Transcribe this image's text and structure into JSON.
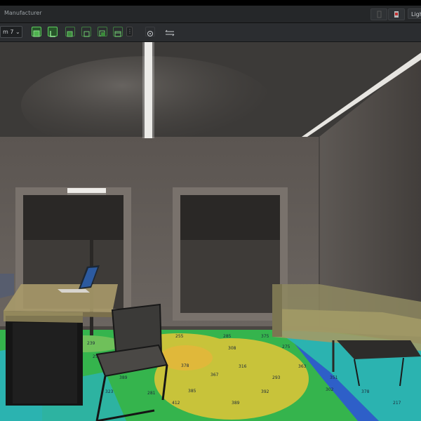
{
  "app": {
    "title": "Manufacturer",
    "right_tab": "Ligh"
  },
  "toolbar": {
    "view_select": "m 7 ⌄",
    "overflow": "⋮",
    "buttons": [
      {
        "name": "view-3d-button",
        "icon": "cube-solid-icon",
        "active": true
      },
      {
        "name": "view-floor-plan-button",
        "icon": "floor-plan-icon",
        "active": true
      },
      {
        "name": "view-front-button",
        "icon": "cube-front-icon",
        "active": false
      },
      {
        "name": "view-side-button",
        "icon": "cube-side-icon",
        "active": false
      },
      {
        "name": "view-back-button",
        "icon": "cube-back-icon",
        "active": false
      },
      {
        "name": "view-top-button",
        "icon": "cube-top-icon",
        "active": false
      }
    ],
    "tools": [
      {
        "name": "focus-tool-button",
        "icon": "target-icon"
      },
      {
        "name": "measure-tool-button",
        "icon": "arrows-horizontal-icon"
      }
    ]
  },
  "colors": {
    "accent_green": "#5fcf5f",
    "heatmap_green": "#35b44d",
    "heatmap_yellow": "#c8c33a",
    "heatmap_cyan": "#2bb3b0",
    "heatmap_blue": "#2e5fc8"
  },
  "scene": {
    "description_icons": [
      "ceiling-light-strip-icon",
      "floor-lamp-icon",
      "laptop-icon",
      "desk-icon",
      "chair-icon",
      "sofa-icon",
      "side-table-icon",
      "window-icon"
    ],
    "illuminance_values": [
      "255",
      "285",
      "375",
      "298",
      "308",
      "275",
      "255",
      "378",
      "316",
      "363",
      "389",
      "367",
      "293",
      "351",
      "385",
      "392",
      "302",
      "239",
      "256",
      "281",
      "323",
      "378",
      "376",
      "412",
      "389",
      "217"
    ]
  }
}
